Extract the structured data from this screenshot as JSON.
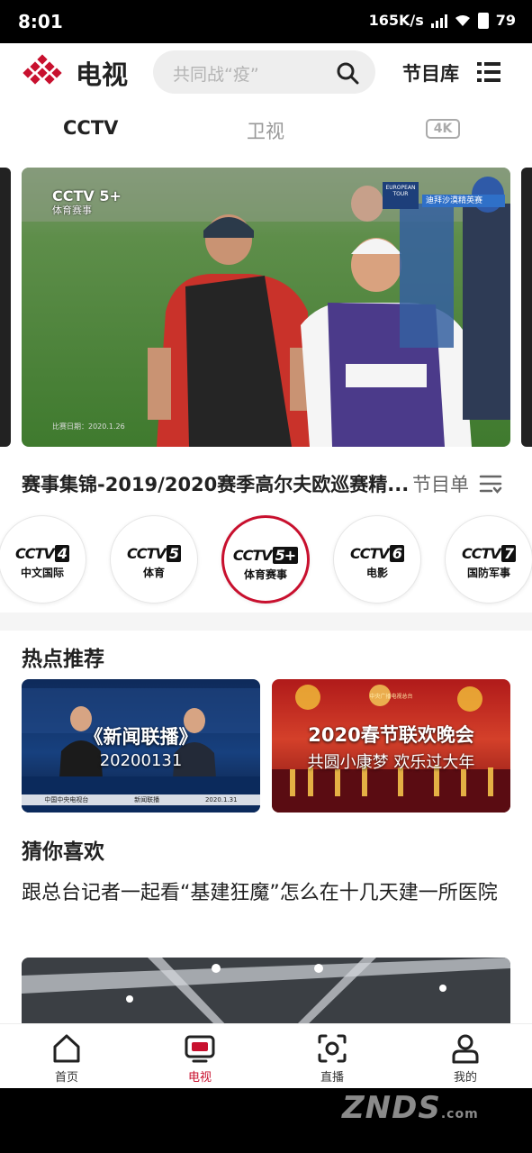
{
  "status_bar": {
    "time": "8:01",
    "net_speed": "165K/s",
    "battery": "79"
  },
  "header": {
    "title": "电视",
    "search_placeholder": "共同战“疫”",
    "library_label": "节目库",
    "brand_color": "#c8102e"
  },
  "tabs": [
    {
      "label": "CCTV",
      "active": true
    },
    {
      "label": "卫视",
      "active": false
    },
    {
      "label": "4K",
      "active": false
    }
  ],
  "hero": {
    "channel_logo": "CCTV 5+",
    "channel_sub": "体育赛事",
    "date_text": "比赛日期：2020.1.26",
    "badge_left": "EUROPEAN TOUR",
    "badge_right": "迪拜沙漠精英赛"
  },
  "now_playing": {
    "title": "赛事集锦-2019/2020赛季高尔夫欧巡赛精...",
    "program_list_label": "节目单"
  },
  "channels": [
    {
      "logo": "CCTV",
      "num": "4",
      "sub": "中文国际",
      "active": false
    },
    {
      "logo": "CCTV",
      "num": "5",
      "sub": "体育",
      "active": false
    },
    {
      "logo": "CCTV",
      "num": "5+",
      "sub": "体育赛事",
      "active": true
    },
    {
      "logo": "CCTV",
      "num": "6",
      "sub": "电影",
      "active": false
    },
    {
      "logo": "CCTV",
      "num": "7",
      "sub": "国防军事",
      "active": false
    }
  ],
  "hot": {
    "title": "热点推荐",
    "cards": [
      {
        "title": "《新闻联播》",
        "subtitle": "20200131",
        "caption_left": "中国中央电视台",
        "caption_mid": "新闻联播",
        "caption_right": "2020.1.31"
      },
      {
        "title": "2020春节联欢晚会",
        "subtitle": "共圆小康梦 欢乐过大年",
        "caption_top": "中央广播电视总台"
      }
    ]
  },
  "guess": {
    "title": "猜你喜欢",
    "item_text": "跟总台记者一起看“基建狂魔”怎么在十几天建一所医院"
  },
  "bottom_nav": [
    {
      "label": "首页",
      "icon": "home-icon",
      "active": false
    },
    {
      "label": "电视",
      "icon": "tv-icon",
      "active": true
    },
    {
      "label": "直播",
      "icon": "live-icon",
      "active": false
    },
    {
      "label": "我的",
      "icon": "profile-icon",
      "active": false
    }
  ],
  "watermark": {
    "text": "ZNDS",
    "suffix": ".com"
  }
}
